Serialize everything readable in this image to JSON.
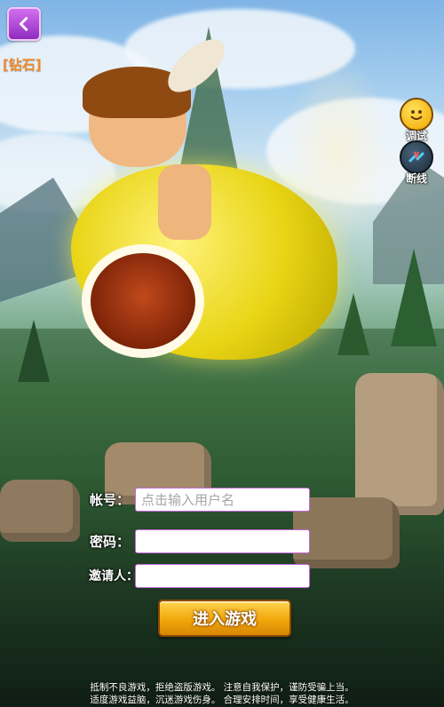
{
  "header": {
    "diamond_label": "[钻石]"
  },
  "side_buttons": {
    "debug_label": "调试",
    "disconnect_label": "断线"
  },
  "login_form": {
    "account_label": "帐号：",
    "account_placeholder": "点击输入用户名",
    "account_value": "",
    "password_label": "密码：",
    "password_value": "",
    "invite_label": "邀请人：",
    "invite_value": "",
    "enter_button_label": "进入游戏"
  },
  "notice": {
    "line1": "抵制不良游戏，拒绝盗版游戏。 注意自我保护，谨防受骗上当。",
    "line2": "适度游戏益脑，沉迷游戏伤身。 合理安排时间，享受健康生活。"
  },
  "colors": {
    "accent_purple": "#a23fd4",
    "button_gold": "#f2a70b",
    "diamond_orange": "#f08a2a"
  },
  "icons": [
    "back-arrow-icon",
    "smiley-icon",
    "disconnect-icon"
  ]
}
